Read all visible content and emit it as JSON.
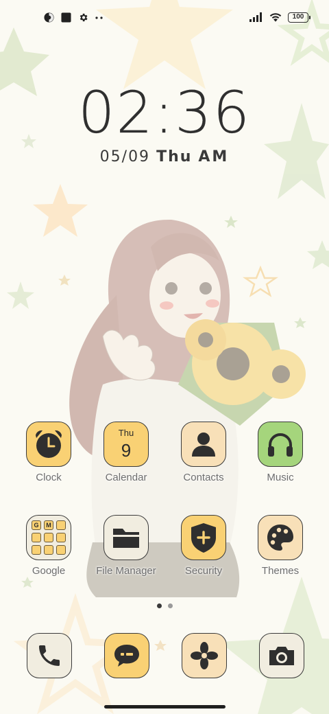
{
  "status_bar": {
    "battery_level": "100",
    "left_icons": [
      "vpn-icon",
      "square-notification-icon",
      "settings-gear-icon",
      "more-dots-icon"
    ],
    "right_icons": [
      "signal-bars-icon",
      "wifi-icon",
      "battery-icon"
    ]
  },
  "clock": {
    "time": "02:36",
    "date": "05/09",
    "weekday": "Thu",
    "ampm": "AM"
  },
  "apps": [
    {
      "label": "Clock",
      "icon": "alarm-clock-icon",
      "color": "#f9d174"
    },
    {
      "label": "Calendar",
      "icon": "calendar-icon",
      "day": "Thu",
      "date": "9",
      "color": "#f9d174"
    },
    {
      "label": "Contacts",
      "icon": "person-icon",
      "color": "#f8e0b8"
    },
    {
      "label": "Music",
      "icon": "headphones-icon",
      "color": "#a5d57c"
    },
    {
      "label": "Google",
      "icon": "google-folder-icon",
      "color": "#f1ede0"
    },
    {
      "label": "File Manager",
      "icon": "folder-icon",
      "color": "#f1ede0"
    },
    {
      "label": "Security",
      "icon": "shield-plus-icon",
      "color": "#f9d174"
    },
    {
      "label": "Themes",
      "icon": "palette-icon",
      "color": "#f8e0b8"
    }
  ],
  "google_folder_letters": [
    "G",
    "M",
    "",
    "",
    "",
    "",
    "",
    "",
    ""
  ],
  "page_indicator": {
    "total": 2,
    "active": 1
  },
  "dock": [
    {
      "name": "Phone",
      "icon": "phone-icon"
    },
    {
      "name": "Messages",
      "icon": "message-bubble-icon"
    },
    {
      "name": "Gallery",
      "icon": "flower-icon"
    },
    {
      "name": "Camera",
      "icon": "camera-icon"
    }
  ]
}
